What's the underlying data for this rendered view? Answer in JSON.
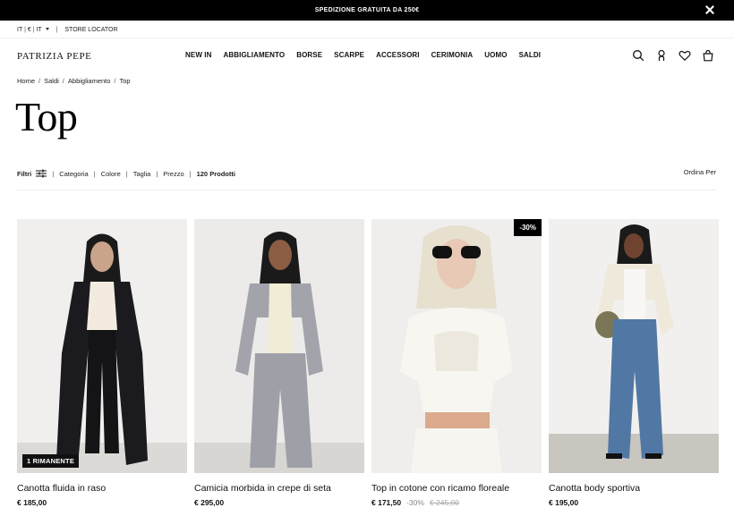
{
  "promo": {
    "text": "SPEDIZIONE GRATUITA DA 250€",
    "close_icon": "close-icon"
  },
  "utility": {
    "lang": "IT",
    "currency": "€",
    "region": "IT",
    "store_locator": "STORE LOCATOR"
  },
  "brand": {
    "logo": "PATRIZIA PEPE"
  },
  "nav": {
    "items": [
      "NEW IN",
      "ABBIGLIAMENTO",
      "BORSE",
      "SCARPE",
      "ACCESSORI",
      "CERIMONIA",
      "UOMO",
      "SALDI"
    ]
  },
  "header_icons": [
    "search-icon",
    "account-icon",
    "wishlist-icon",
    "bag-icon"
  ],
  "breadcrumb": [
    "Home",
    "Saldi",
    "Abbigliamento",
    "Top"
  ],
  "page": {
    "title": "Top"
  },
  "filters": {
    "label": "Filtri",
    "items": [
      "Categoria",
      "Colore",
      "Taglia",
      "Prezzo"
    ],
    "count": "120 Prodotti",
    "sort": "Ordina Per"
  },
  "products": [
    {
      "name": "Canotta fluida in raso",
      "price": "€ 185,00",
      "badge": "1 RIMANENTE"
    },
    {
      "name": "Camicia morbida in crepe di seta",
      "price": "€ 295,00"
    },
    {
      "name": "Top in cotone con ricamo floreale",
      "price": "€ 171,50",
      "discount": "-30%",
      "old_price": "€ 245,00",
      "tag": "-30%"
    },
    {
      "name": "Canotta body sportiva",
      "price": "€ 195,00"
    }
  ],
  "colors": {
    "topbar": "#000000",
    "text": "#111111",
    "muted": "#888888",
    "photo_bg": "#efefef"
  }
}
